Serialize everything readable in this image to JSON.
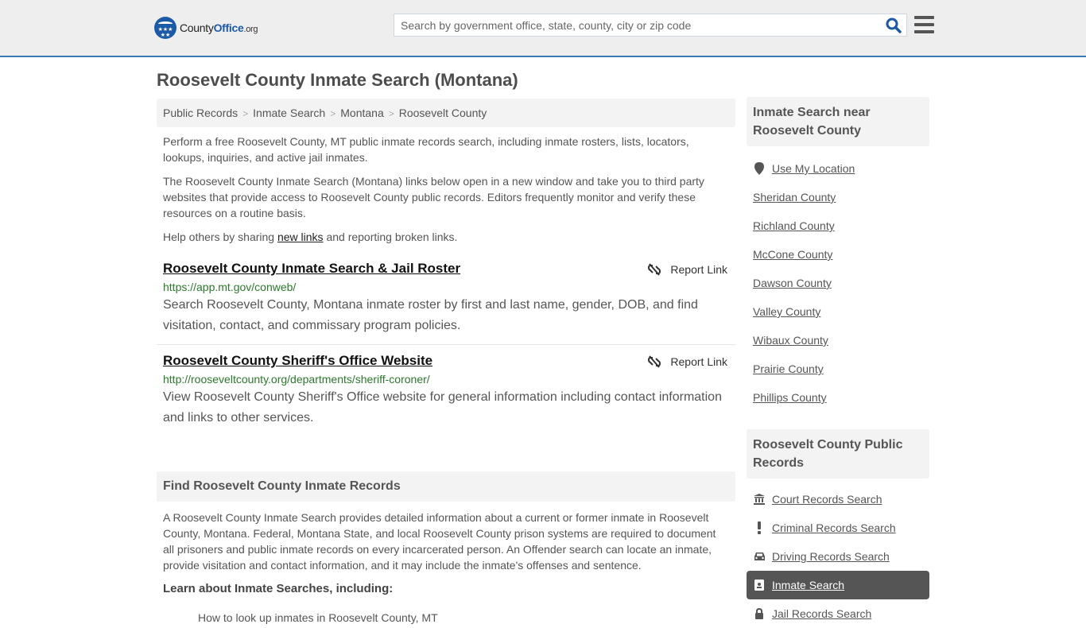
{
  "header": {
    "logo": {
      "prefix": "County",
      "brand": "Office",
      "suffix": ".org"
    },
    "search": {
      "placeholder": "Search by government office, state, county, city or zip code",
      "value": ""
    },
    "colors": {
      "brand_blue": "#1c5aa8",
      "accent_line": "#3b7bb4",
      "link_green": "#2a7a2a"
    }
  },
  "page_title": "Roosevelt County Inmate Search (Montana)",
  "breadcrumb": [
    {
      "label": "Public Records"
    },
    {
      "label": "Inmate Search"
    },
    {
      "label": "Montana"
    },
    {
      "label": "Roosevelt County"
    }
  ],
  "breadcrumb_separator": ">",
  "intro": {
    "p1": "Perform a free Roosevelt County, MT public inmate records search, including inmate rosters, lists, locators, lookups, inquiries, and active jail inmates.",
    "p2": "The Roosevelt County Inmate Search (Montana) links below open in a new window and take you to third party websites that provide access to Roosevelt County public records. Editors frequently monitor and verify these resources on a routine basis.",
    "p3_before": "Help others by sharing ",
    "p3_link": "new links",
    "p3_after": " and reporting broken links."
  },
  "results": [
    {
      "title": "Roosevelt County Inmate Search & Jail Roster",
      "url": "https://app.mt.gov/conweb/",
      "description": "Search Roosevelt County, Montana inmate roster by first and last name, gender, DOB, and find visitation, contact, and commissary program policies.",
      "report_label": "Report Link"
    },
    {
      "title": "Roosevelt County Sheriff's Office Website",
      "url": "http://rooseveltcounty.org/departments/sheriff-coroner/",
      "description": "View Roosevelt County Sheriff's Office website for general information including contact information and links to other services.",
      "report_label": "Report Link"
    }
  ],
  "records_section": {
    "heading": "Find Roosevelt County Inmate Records",
    "body": "A Roosevelt County Inmate Search provides detailed information about a current or former inmate in Roosevelt County, Montana. Federal, Montana State, and local Roosevelt County prison systems are required to document all prisoners and public inmate records on every incarcerated person. An Offender search can locate an inmate, provide visitation and contact information, and it may include the inmate's offenses and sentence.",
    "learn_heading": "Learn about Inmate Searches, including:",
    "list_items": [
      "How to look up inmates in Roosevelt County, MT"
    ]
  },
  "sidebar": {
    "nearby": {
      "heading": "Inmate Search near Roosevelt County",
      "use_location": "Use My Location",
      "counties": [
        "Sheridan County",
        "Richland County",
        "McCone County",
        "Dawson County",
        "Valley County",
        "Wibaux County",
        "Prairie County",
        "Phillips County"
      ]
    },
    "public_records": {
      "heading": "Roosevelt County Public Records",
      "items": [
        {
          "label": "Court Records Search",
          "icon": "courthouse-icon",
          "active": false
        },
        {
          "label": "Criminal Records Search",
          "icon": "exclamation-icon",
          "active": false
        },
        {
          "label": "Driving Records Search",
          "icon": "car-icon",
          "active": false
        },
        {
          "label": "Inmate Search",
          "icon": "id-badge-icon",
          "active": true
        },
        {
          "label": "Jail Records Search",
          "icon": "lock-icon",
          "active": false
        }
      ]
    }
  }
}
